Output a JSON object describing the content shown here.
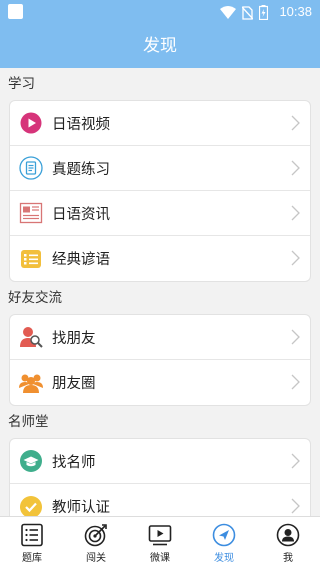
{
  "status": {
    "time": "10:38"
  },
  "header": {
    "title": "发现"
  },
  "sections": [
    {
      "title": "学习",
      "items": [
        {
          "label": "日语视频",
          "icon": "play-circle-icon"
        },
        {
          "label": "真题练习",
          "icon": "exam-paper-icon"
        },
        {
          "label": "日语资讯",
          "icon": "news-icon"
        },
        {
          "label": "经典谚语",
          "icon": "proverb-book-icon"
        }
      ]
    },
    {
      "title": "好友交流",
      "items": [
        {
          "label": "找朋友",
          "icon": "find-person-icon"
        },
        {
          "label": "朋友圈",
          "icon": "people-group-icon"
        }
      ]
    },
    {
      "title": "名师堂",
      "items": [
        {
          "label": "找名师",
          "icon": "graduation-cap-icon"
        },
        {
          "label": "教师认证",
          "icon": "certified-check-icon"
        }
      ]
    }
  ],
  "tabs": [
    {
      "label": "题库",
      "icon": "list-icon"
    },
    {
      "label": "闯关",
      "icon": "target-icon"
    },
    {
      "label": "微课",
      "icon": "video-play-icon"
    },
    {
      "label": "发现",
      "icon": "compass-arrow-icon",
      "active": true
    },
    {
      "label": "我",
      "icon": "user-icon"
    }
  ],
  "colors": {
    "header": "#7fbdf0",
    "active_tab": "#3c8de0"
  }
}
